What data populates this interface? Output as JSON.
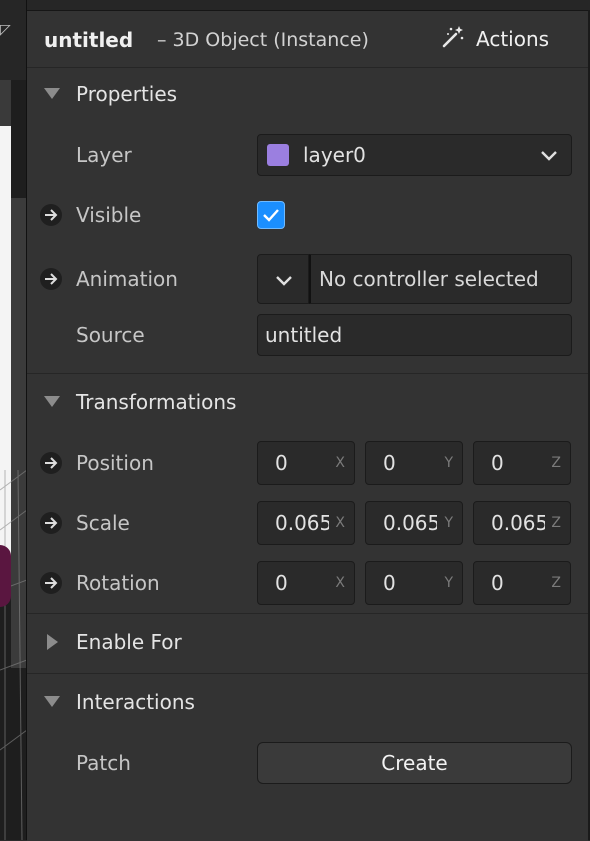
{
  "header": {
    "title": "untitled",
    "subtitle": "– 3D Object (Instance)",
    "actions_label": "Actions",
    "actions_icon": "magic-wand-icon"
  },
  "sections": {
    "properties": "Properties",
    "transformations": "Transformations",
    "enable_for": "Enable For",
    "interactions": "Interactions"
  },
  "properties": {
    "layer_label": "Layer",
    "layer_value": "layer0",
    "layer_color": "#9b7fe0",
    "visible_label": "Visible",
    "visible_checked": true,
    "animation_label": "Animation",
    "animation_value": "No controller selected",
    "source_label": "Source",
    "source_value": "untitled"
  },
  "transformations": {
    "position_label": "Position",
    "scale_label": "Scale",
    "rotation_label": "Rotation",
    "axis_x": "X",
    "axis_y": "Y",
    "axis_z": "Z",
    "position": [
      "0",
      "0",
      "0"
    ],
    "scale": [
      "0.065",
      "0.065",
      "0.065"
    ],
    "rotation": [
      "0",
      "0",
      "0"
    ]
  },
  "interactions": {
    "patch_label": "Patch",
    "create_label": "Create"
  },
  "colors": {
    "accent": "#1b8fff",
    "panel": "#333333",
    "field": "#2a2a2a"
  }
}
